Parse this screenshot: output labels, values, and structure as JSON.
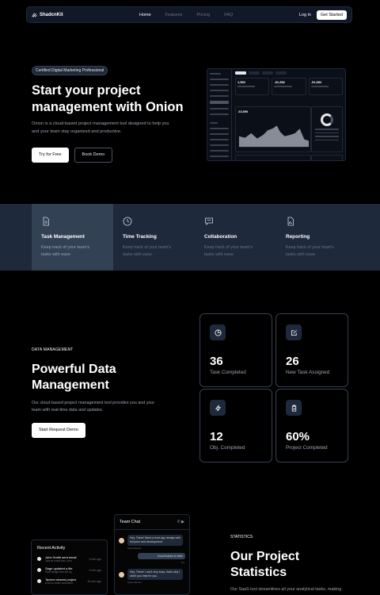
{
  "nav": {
    "brand": "ShadcnKit",
    "links": [
      "Home",
      "Features",
      "Pricing",
      "FAQ"
    ],
    "login": "Log in",
    "cta": "Get Started"
  },
  "hero": {
    "badge": "Certified Digital Marketing Professional",
    "title": "Start your project management with Onion",
    "description": "Onion is a cloud-based project management tool designed to help you and your team stay organized and productive.",
    "primary": "Try for Free",
    "secondary": "Book Demo",
    "dashboard": {
      "values": [
        "1,552",
        "-51,552",
        "-51,552"
      ],
      "chart_value": "23,590"
    }
  },
  "features": [
    {
      "title": "Task Management",
      "desc": "Keep track of your team's tasks with ease",
      "icon": "file-icon"
    },
    {
      "title": "Time Tracking",
      "desc": "Keep track of your team's tasks with ease",
      "icon": "clock-icon"
    },
    {
      "title": "Collaboration",
      "desc": "Keep track of your team's tasks with ease",
      "icon": "message-icon"
    },
    {
      "title": "Reporting",
      "desc": "Keep track of your team's tasks with ease",
      "icon": "report-icon"
    }
  ],
  "data_management": {
    "kicker": "DATA MANAGEMENT",
    "title": "Powerful Data Management",
    "description": "Our cloud-based project management tool provides you and your team with real-time data and updates.",
    "button": "Start Request Demo",
    "stats": [
      {
        "value": "36",
        "label": "Task Completed",
        "icon": "pie-chart-icon"
      },
      {
        "value": "26",
        "label": "New Task Assigned",
        "icon": "edit-icon"
      },
      {
        "value": "12",
        "label": "Obj. Completed",
        "icon": "zap-icon"
      },
      {
        "value": "60%",
        "label": "Project Completed",
        "icon": "clipboard-icon"
      }
    ]
  },
  "activity": {
    "title": "Recent Activity",
    "items": [
      {
        "main": "John Smith sent email",
        "sub": "Just an email from John",
        "time": "5 min ago"
      },
      {
        "main": "Sage updated a file",
        "sub": "Final design files are up",
        "time": "5 min ago"
      },
      {
        "main": "Taveen shared project",
        "sub": "A link to share document",
        "time": "5h min ago"
      }
    ]
  },
  "chat": {
    "title": "Team Chat",
    "msg1": "Hey, There! Need a front-app design with full price and development.",
    "who1": "Susan Brown",
    "mine": "Good thanks to hello",
    "mine_time": "Yes",
    "msg2": "Hey, There! I can't very busy, that's why I didn't you help for you.",
    "who2": "Susan Brown"
  },
  "statistics": {
    "kicker": "STATISTICS",
    "title": "Our Project Statistics",
    "description": "Our SaaS tool streamlines all your analytical tasks, making"
  }
}
